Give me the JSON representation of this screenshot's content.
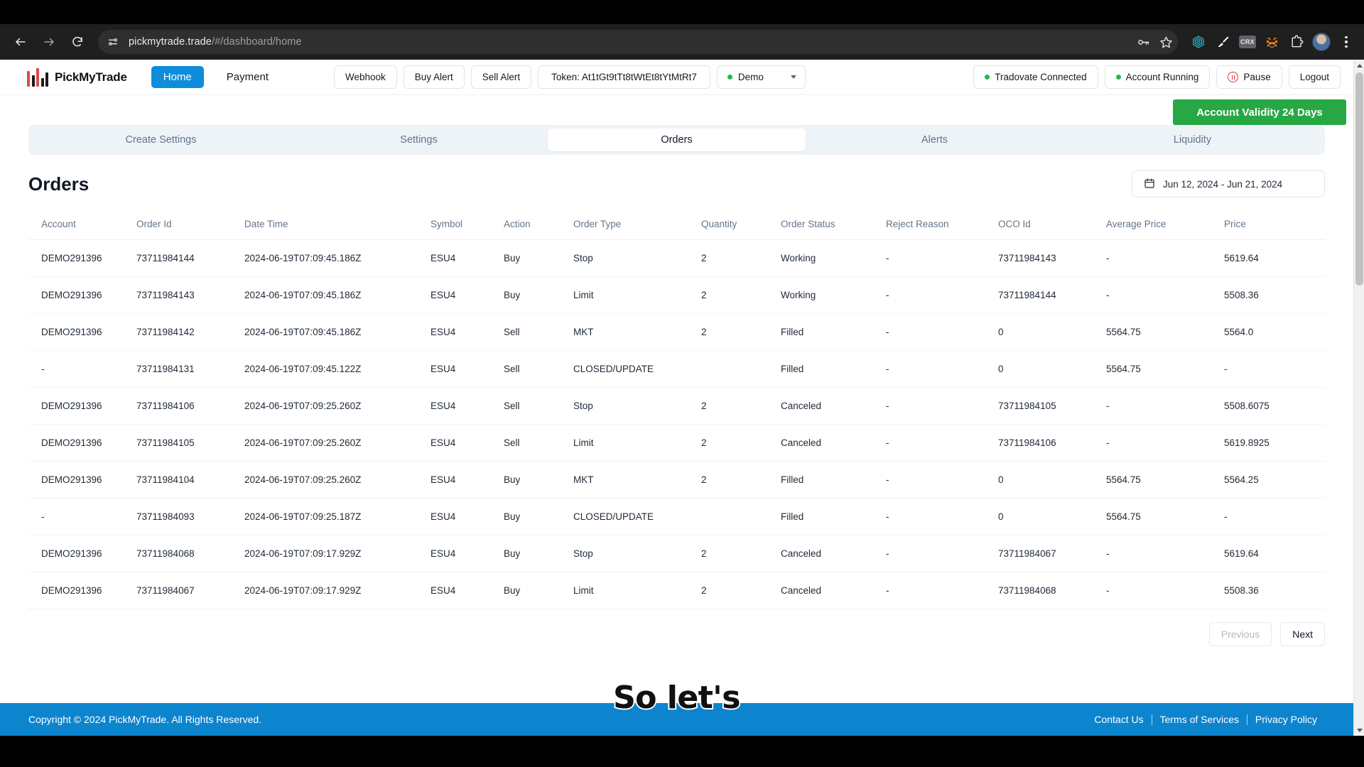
{
  "browser": {
    "url_bold": "pickmytrade.trade",
    "url_dim": "/#/dashboard/home",
    "back_label": "Back",
    "forward_label": "Forward",
    "reload_label": "Reload",
    "site_info_label": "site-settings",
    "password_label": "Save password",
    "bookmark_label": "Bookmark this tab",
    "ext_crx_label": "CRX",
    "ext_metamask_label": "MetaMask",
    "ext_broom_label": "Cleaner",
    "ext_teal_label": "Extension",
    "ext_puzzle_label": "Extensions",
    "profile_label": "Profile",
    "menu_label": "Customize and control Chrome"
  },
  "header": {
    "brand": "PickMyTrade",
    "nav": [
      {
        "label": "Home",
        "active": true
      },
      {
        "label": "Payment",
        "active": false
      }
    ],
    "buttons": [
      {
        "label": "Webhook"
      },
      {
        "label": "Buy Alert"
      },
      {
        "label": "Sell Alert"
      }
    ],
    "token_label": "Token: At1tGt9tTt8tWtEt8tYtMtRt7",
    "account_select": "Demo",
    "broker_status": "Tradovate Connected",
    "account_status": "Account Running",
    "pause_label": "Pause",
    "logout_label": "Logout",
    "status_dot_color": "#21ba45",
    "brand_blue": "#0d8ddb",
    "pause_red": "#dc3545"
  },
  "validity": {
    "label": "Account Validity 24 Days",
    "color": "#28a745"
  },
  "tabs": [
    {
      "label": "Create Settings",
      "active": false
    },
    {
      "label": "Settings",
      "active": false
    },
    {
      "label": "Orders",
      "active": true
    },
    {
      "label": "Alerts",
      "active": false
    },
    {
      "label": "Liquidity",
      "active": false
    }
  ],
  "orders_section": {
    "title": "Orders",
    "date_range": "Jun 12, 2024 - Jun 21, 2024",
    "calendar_icon": "calendar-icon"
  },
  "table": {
    "columns": [
      "Account",
      "Order Id",
      "Date Time",
      "Symbol",
      "Action",
      "Order Type",
      "Quantity",
      "Order Status",
      "Reject Reason",
      "OCO Id",
      "Average Price",
      "Price"
    ],
    "rows": [
      [
        "DEMO291396",
        "73711984144",
        "2024-06-19T07:09:45.186Z",
        "ESU4",
        "Buy",
        "Stop",
        "2",
        "Working",
        "-",
        "73711984143",
        "-",
        "5619.64"
      ],
      [
        "DEMO291396",
        "73711984143",
        "2024-06-19T07:09:45.186Z",
        "ESU4",
        "Buy",
        "Limit",
        "2",
        "Working",
        "-",
        "73711984144",
        "-",
        "5508.36"
      ],
      [
        "DEMO291396",
        "73711984142",
        "2024-06-19T07:09:45.186Z",
        "ESU4",
        "Sell",
        "MKT",
        "2",
        "Filled",
        "-",
        "0",
        "5564.75",
        "5564.0"
      ],
      [
        "-",
        "73711984131",
        "2024-06-19T07:09:45.122Z",
        "ESU4",
        "Sell",
        "CLOSED/UPDATE",
        "",
        "Filled",
        "-",
        "0",
        "5564.75",
        "-"
      ],
      [
        "DEMO291396",
        "73711984106",
        "2024-06-19T07:09:25.260Z",
        "ESU4",
        "Sell",
        "Stop",
        "2",
        "Canceled",
        "-",
        "73711984105",
        "-",
        "5508.6075"
      ],
      [
        "DEMO291396",
        "73711984105",
        "2024-06-19T07:09:25.260Z",
        "ESU4",
        "Sell",
        "Limit",
        "2",
        "Canceled",
        "-",
        "73711984106",
        "-",
        "5619.8925"
      ],
      [
        "DEMO291396",
        "73711984104",
        "2024-06-19T07:09:25.260Z",
        "ESU4",
        "Buy",
        "MKT",
        "2",
        "Filled",
        "-",
        "0",
        "5564.75",
        "5564.25"
      ],
      [
        "-",
        "73711984093",
        "2024-06-19T07:09:25.187Z",
        "ESU4",
        "Buy",
        "CLOSED/UPDATE",
        "",
        "Filled",
        "-",
        "0",
        "5564.75",
        "-"
      ],
      [
        "DEMO291396",
        "73711984068",
        "2024-06-19T07:09:17.929Z",
        "ESU4",
        "Buy",
        "Stop",
        "2",
        "Canceled",
        "-",
        "73711984067",
        "-",
        "5619.64"
      ],
      [
        "DEMO291396",
        "73711984067",
        "2024-06-19T07:09:17.929Z",
        "ESU4",
        "Buy",
        "Limit",
        "2",
        "Canceled",
        "-",
        "73711984068",
        "-",
        "5508.36"
      ]
    ]
  },
  "pagination": {
    "previous": "Previous",
    "next": "Next"
  },
  "footer": {
    "copyright": "Copyright © 2024 PickMyTrade. All Rights Reserved.",
    "links": [
      "Contact Us",
      "Terms of Services",
      "Privacy Policy"
    ],
    "bg": "#0d84ce"
  },
  "overlay": {
    "caption": "So let's"
  }
}
